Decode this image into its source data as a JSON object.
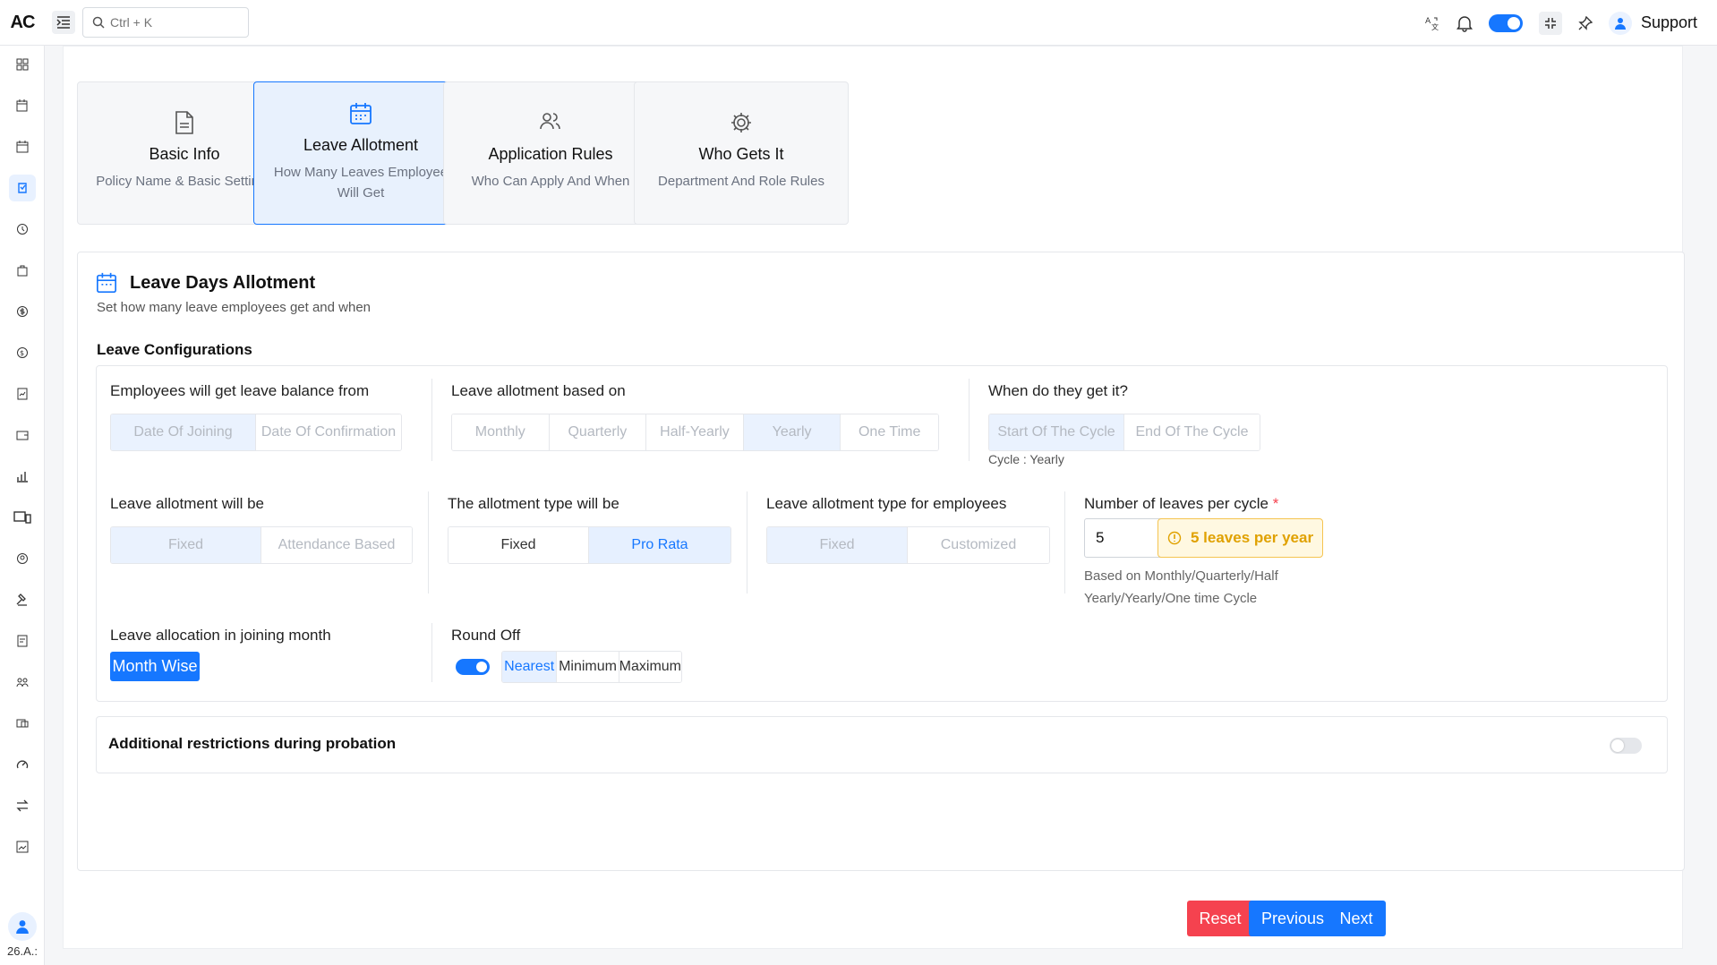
{
  "app": {
    "logo": "AC",
    "user_short": "26.A.:"
  },
  "topbar": {
    "search_placeholder": "Ctrl + K",
    "support_label": "Support"
  },
  "steps": [
    {
      "title": "Basic Info",
      "subtitle": "Policy Name & Basic Settings",
      "icon": "document-icon"
    },
    {
      "title": "Leave Allotment",
      "subtitle": "How Many Leaves Employee Will Get",
      "icon": "calendar-icon"
    },
    {
      "title": "Application Rules",
      "subtitle": "Who Can Apply And When",
      "icon": "users-icon"
    },
    {
      "title": "Who Gets It",
      "subtitle": "Department And Role Rules",
      "icon": "gear-icon"
    }
  ],
  "card": {
    "title": "Leave Days Allotment",
    "subtitle": "Set how many leave employees get and when",
    "section_title": "Leave Configurations"
  },
  "config": {
    "balance_from": {
      "label": "Employees will get leave balance from",
      "options": [
        "Date Of Joining",
        "Date Of Confirmation"
      ],
      "selected": "Date Of Joining"
    },
    "based_on": {
      "label": "Leave allotment based on",
      "options": [
        "Monthly",
        "Quarterly",
        "Half-Yearly",
        "Yearly",
        "One Time"
      ],
      "selected": "Yearly"
    },
    "when": {
      "label": "When do they get it?",
      "options": [
        "Start Of The Cycle",
        "End Of The Cycle"
      ],
      "selected": "Start Of The Cycle",
      "cycle_note": "Cycle : Yearly"
    },
    "allotment_will_be": {
      "label": "Leave allotment will be",
      "options": [
        "Fixed",
        "Attendance Based"
      ],
      "selected": "Fixed"
    },
    "allotment_type": {
      "label": "The allotment type will be",
      "options": [
        "Fixed",
        "Pro Rata"
      ],
      "selected": "Pro Rata"
    },
    "type_for_employees": {
      "label": "Leave allotment type for employees",
      "options": [
        "Fixed",
        "Customized"
      ],
      "selected": "Fixed"
    },
    "leaves_per_cycle": {
      "label": "Number of leaves per cycle",
      "required_mark": "*",
      "value": "5",
      "badge": "5 leaves per year",
      "hint": "Based on Monthly/Quarterly/Half Yearly/Yearly/One time Cycle"
    },
    "joining_month": {
      "label": "Leave allocation in joining month",
      "button": "Month Wise"
    },
    "round_off": {
      "label": "Round Off",
      "enabled": true,
      "options": [
        "Nearest",
        "Minimum",
        "Maximum"
      ],
      "selected": "Nearest"
    }
  },
  "restrictions": {
    "label": "Additional restrictions during probation",
    "enabled": false
  },
  "footer": {
    "reset": "Reset",
    "previous": "Previous",
    "next": "Next"
  },
  "colors": {
    "primary": "#1677ff",
    "danger": "#f5424f",
    "warning": "#f5c451"
  }
}
